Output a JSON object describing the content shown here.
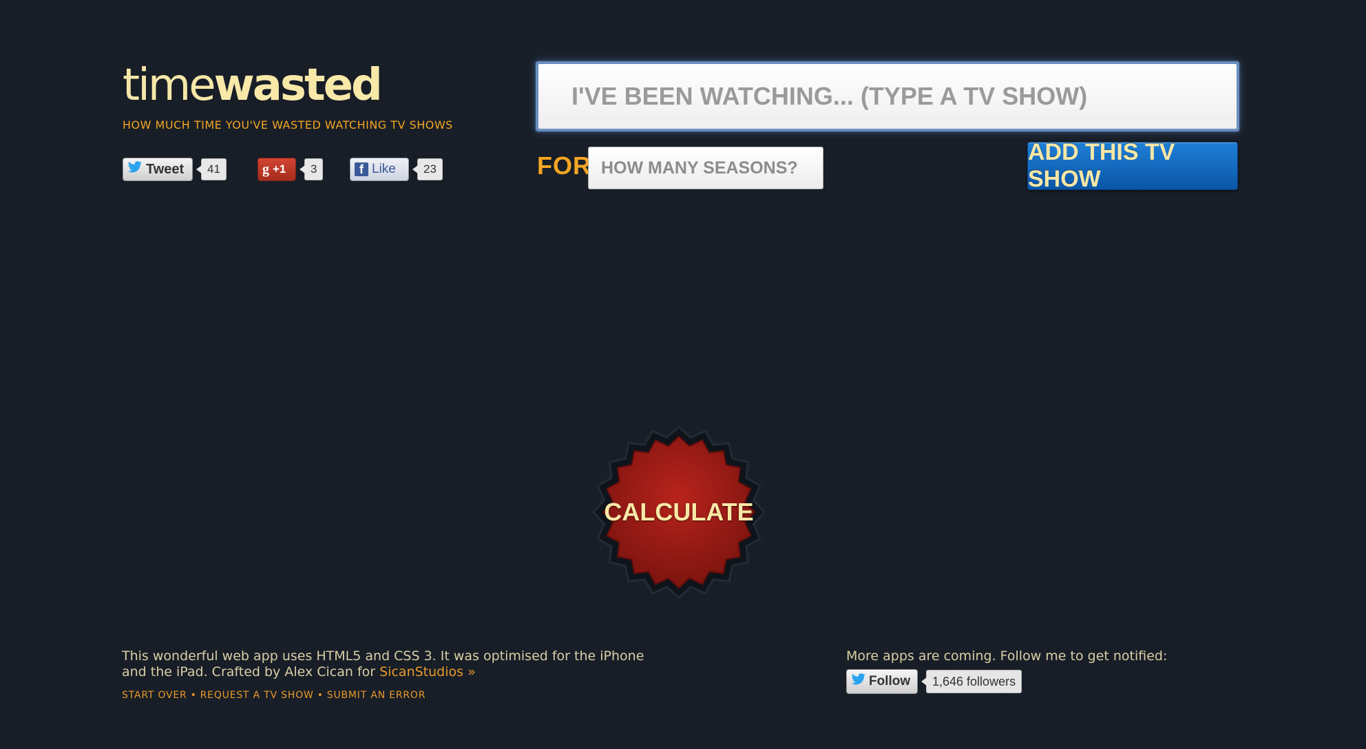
{
  "logo": {
    "light": "time",
    "bold": "wasted"
  },
  "tagline": "HOW MUCH TIME YOU'VE WASTED WATCHING TV SHOWS",
  "social": {
    "tweet_label": "Tweet",
    "tweet_count": "41",
    "gplus_label": "+1",
    "gplus_count": "3",
    "like_label": "Like",
    "like_count": "23"
  },
  "show_input": {
    "placeholder": "I'VE BEEN WATCHING... (TYPE A TV SHOW)",
    "value": ""
  },
  "for_label": "FOR",
  "seasons_input": {
    "placeholder": "HOW MANY SEASONS?",
    "value": ""
  },
  "add_button_label": "ADD THIS TV SHOW",
  "calculate_label": "CALCULATE",
  "footer": {
    "text_part1": "This wonderful web app uses HTML5 and CSS 3. It was optimised for the iPhone and the iPad. Crafted by Alex Cican for ",
    "studio_link": "SicanStudios »",
    "links": [
      "START OVER",
      "REQUEST A TV SHOW",
      "SUBMIT AN ERROR"
    ],
    "right_text": "More apps are coming. Follow me to get notified:",
    "follow_label": "Follow",
    "followers": "1,646 followers"
  },
  "colors": {
    "background": "#171d26",
    "accent_orange": "#f5a623",
    "cream": "#f6e7a8",
    "button_blue": "#0a56a8",
    "badge_red": "#a81f1a"
  }
}
